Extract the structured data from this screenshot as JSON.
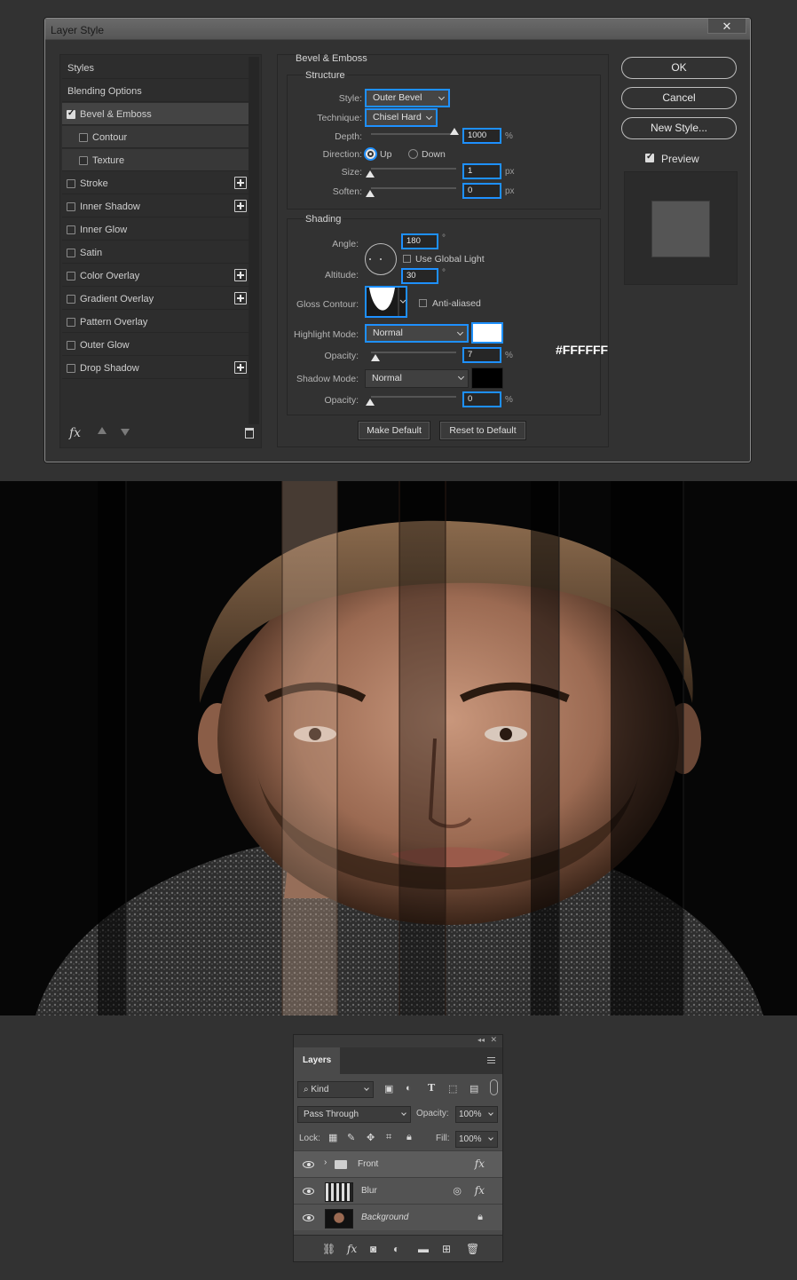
{
  "dialog": {
    "title": "Layer Style",
    "styles_list": [
      {
        "label": "Styles",
        "checkbox": false,
        "plus": false
      },
      {
        "label": "Blending Options",
        "checkbox": false,
        "plus": false
      },
      {
        "label": "Bevel & Emboss",
        "checkbox": true,
        "checked": true,
        "plus": false,
        "selected": true
      },
      {
        "label": "Contour",
        "checkbox": true,
        "checked": false,
        "plus": false,
        "sub": true
      },
      {
        "label": "Texture",
        "checkbox": true,
        "checked": false,
        "plus": false,
        "sub": true
      },
      {
        "label": "Stroke",
        "checkbox": true,
        "checked": false,
        "plus": true
      },
      {
        "label": "Inner Shadow",
        "checkbox": true,
        "checked": false,
        "plus": true
      },
      {
        "label": "Inner Glow",
        "checkbox": true,
        "checked": false,
        "plus": false
      },
      {
        "label": "Satin",
        "checkbox": true,
        "checked": false,
        "plus": false
      },
      {
        "label": "Color Overlay",
        "checkbox": true,
        "checked": false,
        "plus": true
      },
      {
        "label": "Gradient Overlay",
        "checkbox": true,
        "checked": false,
        "plus": true
      },
      {
        "label": "Pattern Overlay",
        "checkbox": true,
        "checked": false,
        "plus": false
      },
      {
        "label": "Outer Glow",
        "checkbox": true,
        "checked": false,
        "plus": false
      },
      {
        "label": "Drop Shadow",
        "checkbox": true,
        "checked": false,
        "plus": true
      }
    ],
    "footer_fx": "fx",
    "bevel": {
      "section_title": "Bevel & Emboss",
      "structure_title": "Structure",
      "style_label": "Style:",
      "style_value": "Outer Bevel",
      "technique_label": "Technique:",
      "technique_value": "Chisel Hard",
      "depth_label": "Depth:",
      "depth_value": "1000",
      "depth_unit": "%",
      "direction_label": "Direction:",
      "direction_up": "Up",
      "direction_down": "Down",
      "size_label": "Size:",
      "size_value": "1",
      "size_unit": "px",
      "soften_label": "Soften:",
      "soften_value": "0",
      "soften_unit": "px"
    },
    "shading": {
      "title": "Shading",
      "angle_label": "Angle:",
      "angle_value": "180",
      "degree": "°",
      "global_light": "Use Global Light",
      "altitude_label": "Altitude:",
      "altitude_value": "30",
      "gloss_label": "Gloss Contour:",
      "anti_aliased": "Anti-aliased",
      "highlight_mode_label": "Highlight Mode:",
      "highlight_mode_value": "Normal",
      "highlight_color": "#FFFFFF",
      "highlight_hex_caption": "#FFFFFF",
      "highlight_opacity_label": "Opacity:",
      "highlight_opacity_value": "7",
      "percent": "%",
      "shadow_mode_label": "Shadow Mode:",
      "shadow_mode_value": "Normal",
      "shadow_color": "#000000",
      "shadow_opacity_label": "Opacity:",
      "shadow_opacity_value": "0"
    },
    "make_default": "Make Default",
    "reset_default": "Reset to Default",
    "ok": "OK",
    "cancel": "Cancel",
    "new_style": "New Style...",
    "preview_label": "Preview",
    "accent_color": "#1E90FF"
  },
  "layers_panel": {
    "tab": "Layers",
    "kind": "Kind",
    "blend_mode": "Pass Through",
    "opacity_label": "Opacity:",
    "opacity_value": "100%",
    "lock_label": "Lock:",
    "fill_label": "Fill:",
    "fill_value": "100%",
    "layers": [
      {
        "name": "Front",
        "type": "group",
        "fx": "fx",
        "selected": true
      },
      {
        "name": "Blur",
        "type": "smart",
        "fx": "fx"
      },
      {
        "name": "Background",
        "type": "image",
        "locked": true
      }
    ]
  }
}
